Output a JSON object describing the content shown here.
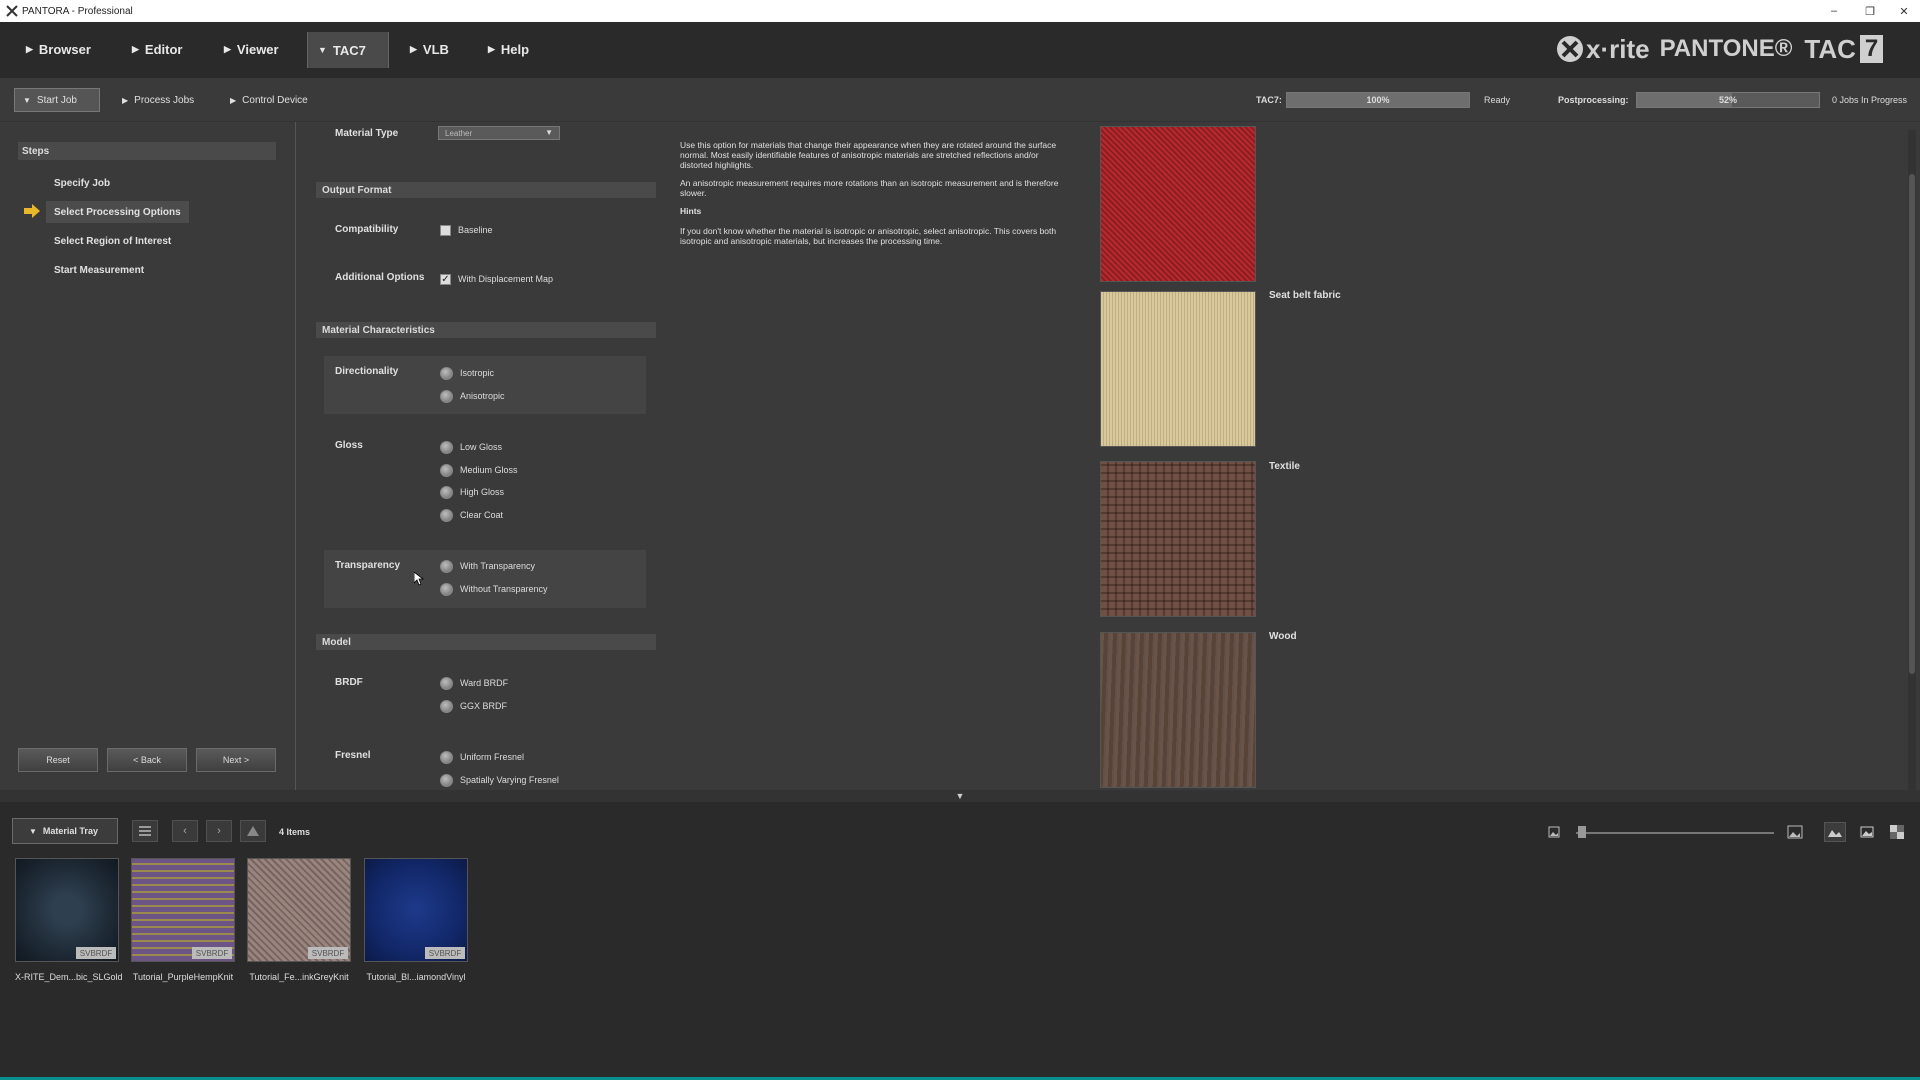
{
  "window": {
    "title": "PANTORA - Professional",
    "controls": [
      "–",
      "❐",
      "✕"
    ]
  },
  "menu": {
    "items": [
      {
        "label": "Browser",
        "marker": "▶"
      },
      {
        "label": "Editor",
        "marker": "▶"
      },
      {
        "label": "Viewer",
        "marker": "▶"
      },
      {
        "label": "TAC7",
        "marker": "▼"
      },
      {
        "label": "VLB",
        "marker": "▶"
      },
      {
        "label": "Help",
        "marker": "▶"
      }
    ],
    "brand": {
      "xrite": "x·rite",
      "pantone": "PANTONE®",
      "tac": "TAC",
      "tac_num": "7"
    }
  },
  "subbar": {
    "tabs": [
      {
        "label": "Start Job",
        "marker": "▼"
      },
      {
        "label": "Process Jobs",
        "marker": "▶"
      },
      {
        "label": "Control Device",
        "marker": "▶"
      }
    ],
    "tac7_label": "TAC7:",
    "tac7_progress": 100,
    "tac7_progress_text": "100%",
    "tac7_status": "Ready",
    "post_label": "Postprocessing:",
    "post_progress": 52,
    "post_progress_text": "52%",
    "jobs_text": "0 Jobs In Progress"
  },
  "steps": {
    "title": "Steps",
    "items": [
      "Specify Job",
      "Select Processing Options",
      "Select Region of Interest",
      "Start Measurement"
    ],
    "active_index": 1,
    "buttons": {
      "reset": "Reset",
      "back": "< Back",
      "next": "Next >"
    }
  },
  "options": {
    "material_type_label": "Material Type",
    "material_type_value": "Leather",
    "output_format": {
      "title": "Output Format",
      "compatibility_label": "Compatibility",
      "baseline": "Baseline",
      "baseline_checked": false,
      "additional_label": "Additional Options",
      "displacement": "With Displacement Map",
      "displacement_checked": true
    },
    "material_characteristics": {
      "title": "Material Characteristics",
      "directionality_label": "Directionality",
      "directionality": [
        "Isotropic",
        "Anisotropic"
      ],
      "gloss_label": "Gloss",
      "gloss": [
        "Low Gloss",
        "Medium Gloss",
        "High Gloss",
        "Clear Coat"
      ],
      "transparency_label": "Transparency",
      "transparency": [
        "With Transparency",
        "Without Transparency"
      ]
    },
    "model": {
      "title": "Model",
      "brdf_label": "BRDF",
      "brdf": [
        "Ward BRDF",
        "GGX BRDF"
      ],
      "fresnel_label": "Fresnel",
      "fresnel": [
        "Uniform Fresnel",
        "Spatially Varying Fresnel"
      ]
    }
  },
  "help": {
    "p1": "Use this option for materials that change their appearance when they are rotated around the surface normal. Most easily identifiable features of anisotropic materials are stretched reflections and/or distorted highlights.",
    "p2": "An anisotropic measurement requires more rotations than an isotropic measurement and is therefore slower.",
    "hints_title": "Hints",
    "p3": "If you don't know whether the material is isotropic or anisotropic, select anisotropic. This covers both isotropic and anisotropic materials, but increases the processing time."
  },
  "samples": [
    {
      "label": "",
      "color": "#a8262a"
    },
    {
      "label": "Seat belt fabric",
      "color": "#cdbd92"
    },
    {
      "label": "Textile",
      "color": "#9c8378"
    },
    {
      "label": "Wood",
      "color": "#5e4a40"
    }
  ],
  "tray": {
    "tab_label": "Material Tray",
    "tab_marker": "▼",
    "count_text": "4 Items",
    "badge": "SVBRDF",
    "items": [
      {
        "name": "X-RITE_Dem...bic_SLGold",
        "color": "#1e2a36"
      },
      {
        "name": "Tutorial_PurpleHempKnit",
        "color": "#5a4470"
      },
      {
        "name": "Tutorial_Fe...inkGreyKnit",
        "color": "#8a7470"
      },
      {
        "name": "Tutorial_Bl...iamondVinyl",
        "color": "#12286a"
      }
    ]
  },
  "icons": [
    "app-icon",
    "arrow-right-icon",
    "list-icon",
    "back-icon",
    "forward-icon",
    "up-icon",
    "image-small-icon",
    "image-large-icon",
    "landscape-icon",
    "photo-icon",
    "checker-icon",
    "chevron-down-icon"
  ]
}
